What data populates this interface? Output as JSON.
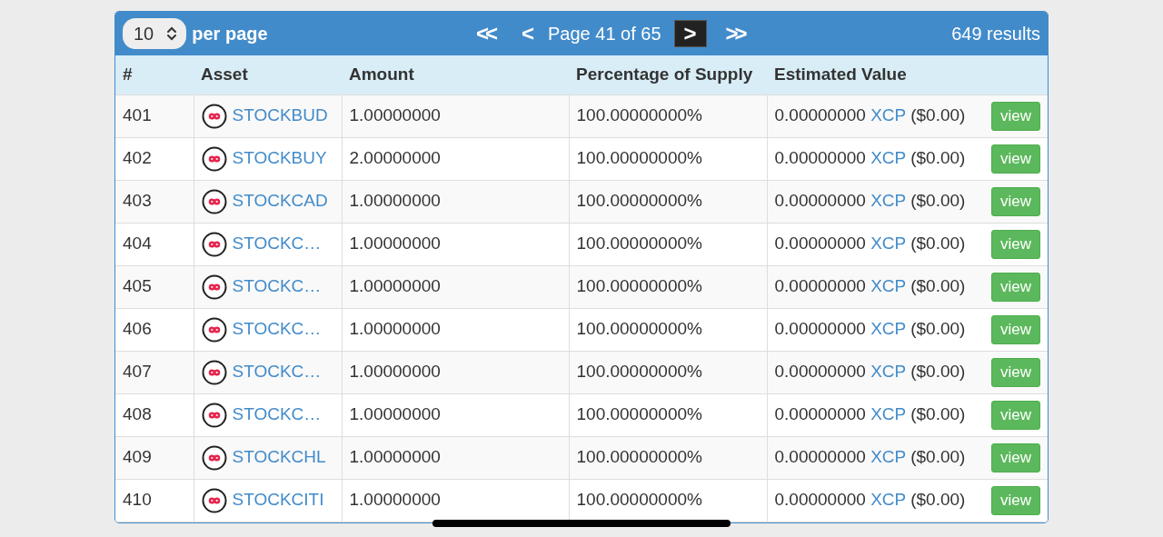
{
  "pagination": {
    "per_page": "10",
    "per_page_label": "per page",
    "first": "<<",
    "prev": "<",
    "page_label": "Page 41 of 65",
    "next": ">",
    "last": ">>",
    "results": "649 results"
  },
  "table": {
    "columns": [
      "#",
      "Asset",
      "Amount",
      "Percentage of Supply",
      "Estimated Value"
    ],
    "rows": [
      {
        "number": "401",
        "asset": "STOCKBUD",
        "amount": "1.00000000",
        "percentage": "100.00000000%",
        "value": "0.00000000",
        "unit": "XCP",
        "usd": "($0.00)",
        "action": "view"
      },
      {
        "number": "402",
        "asset": "STOCKBUY",
        "amount": "2.00000000",
        "percentage": "100.00000000%",
        "value": "0.00000000",
        "unit": "XCP",
        "usd": "($0.00)",
        "action": "view"
      },
      {
        "number": "403",
        "asset": "STOCKCAD",
        "amount": "1.00000000",
        "percentage": "100.00000000%",
        "value": "0.00000000",
        "unit": "XCP",
        "usd": "($0.00)",
        "action": "view"
      },
      {
        "number": "404",
        "asset": "STOCKC…",
        "amount": "1.00000000",
        "percentage": "100.00000000%",
        "value": "0.00000000",
        "unit": "XCP",
        "usd": "($0.00)",
        "action": "view"
      },
      {
        "number": "405",
        "asset": "STOCKC…",
        "amount": "1.00000000",
        "percentage": "100.00000000%",
        "value": "0.00000000",
        "unit": "XCP",
        "usd": "($0.00)",
        "action": "view"
      },
      {
        "number": "406",
        "asset": "STOCKC…",
        "amount": "1.00000000",
        "percentage": "100.00000000%",
        "value": "0.00000000",
        "unit": "XCP",
        "usd": "($0.00)",
        "action": "view"
      },
      {
        "number": "407",
        "asset": "STOCKC…",
        "amount": "1.00000000",
        "percentage": "100.00000000%",
        "value": "0.00000000",
        "unit": "XCP",
        "usd": "($0.00)",
        "action": "view"
      },
      {
        "number": "408",
        "asset": "STOCKC…",
        "amount": "1.00000000",
        "percentage": "100.00000000%",
        "value": "0.00000000",
        "unit": "XCP",
        "usd": "($0.00)",
        "action": "view"
      },
      {
        "number": "409",
        "asset": "STOCKCHL",
        "amount": "1.00000000",
        "percentage": "100.00000000%",
        "value": "0.00000000",
        "unit": "XCP",
        "usd": "($0.00)",
        "action": "view"
      },
      {
        "number": "410",
        "asset": "STOCKCITI",
        "amount": "1.00000000",
        "percentage": "100.00000000%",
        "value": "0.00000000",
        "unit": "XCP",
        "usd": "($0.00)",
        "action": "view"
      }
    ]
  }
}
